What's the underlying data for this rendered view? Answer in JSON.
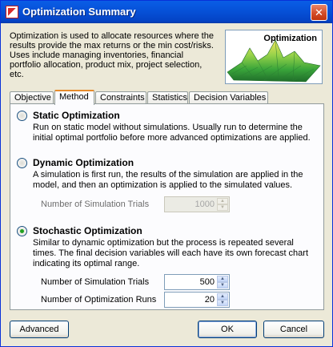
{
  "window": {
    "title": "Optimization Summary",
    "close_glyph": "✕"
  },
  "intro": {
    "text": "Optimization is used to allocate resources where the results provide the max returns or the min cost/risks. Uses include managing inventories, financial portfolio allocation, product mix, project selection, etc."
  },
  "preview": {
    "label": "Optimization",
    "icon": "3d-surface-image"
  },
  "tabs": [
    {
      "label": "Objective",
      "active": false
    },
    {
      "label": "Method",
      "active": true
    },
    {
      "label": "Constraints",
      "active": false
    },
    {
      "label": "Statistics",
      "active": false
    },
    {
      "label": "Decision Variables",
      "active": false
    }
  ],
  "method": {
    "static": {
      "title": "Static Optimization",
      "description": "Run on static model without simulations. Usually run to determine the initial optimal portfolio before more advanced optimizations are applied.",
      "selected": false
    },
    "dynamic": {
      "title": "Dynamic Optimization",
      "description": "A simulation is first run, the results of the simulation are applied in the model, and then an optimization is applied to the simulated values.",
      "selected": false,
      "trials_label": "Number of Simulation Trials",
      "trials_value": "1000"
    },
    "stochastic": {
      "title": "Stochastic Optimization",
      "description": "Similar to dynamic optimization but the process is repeated several times. The final decision variables will each have its own forecast chart indicating its optimal range.",
      "selected": true,
      "trials_label": "Number of Simulation Trials",
      "trials_value": "500",
      "runs_label": "Number of Optimization Runs",
      "runs_value": "20"
    }
  },
  "buttons": {
    "advanced": "Advanced",
    "ok": "OK",
    "cancel": "Cancel"
  },
  "colors": {
    "titlebar": "#0a5ee6",
    "active_tab_accent": "#e68b2c",
    "radio_dot": "#21a121"
  }
}
